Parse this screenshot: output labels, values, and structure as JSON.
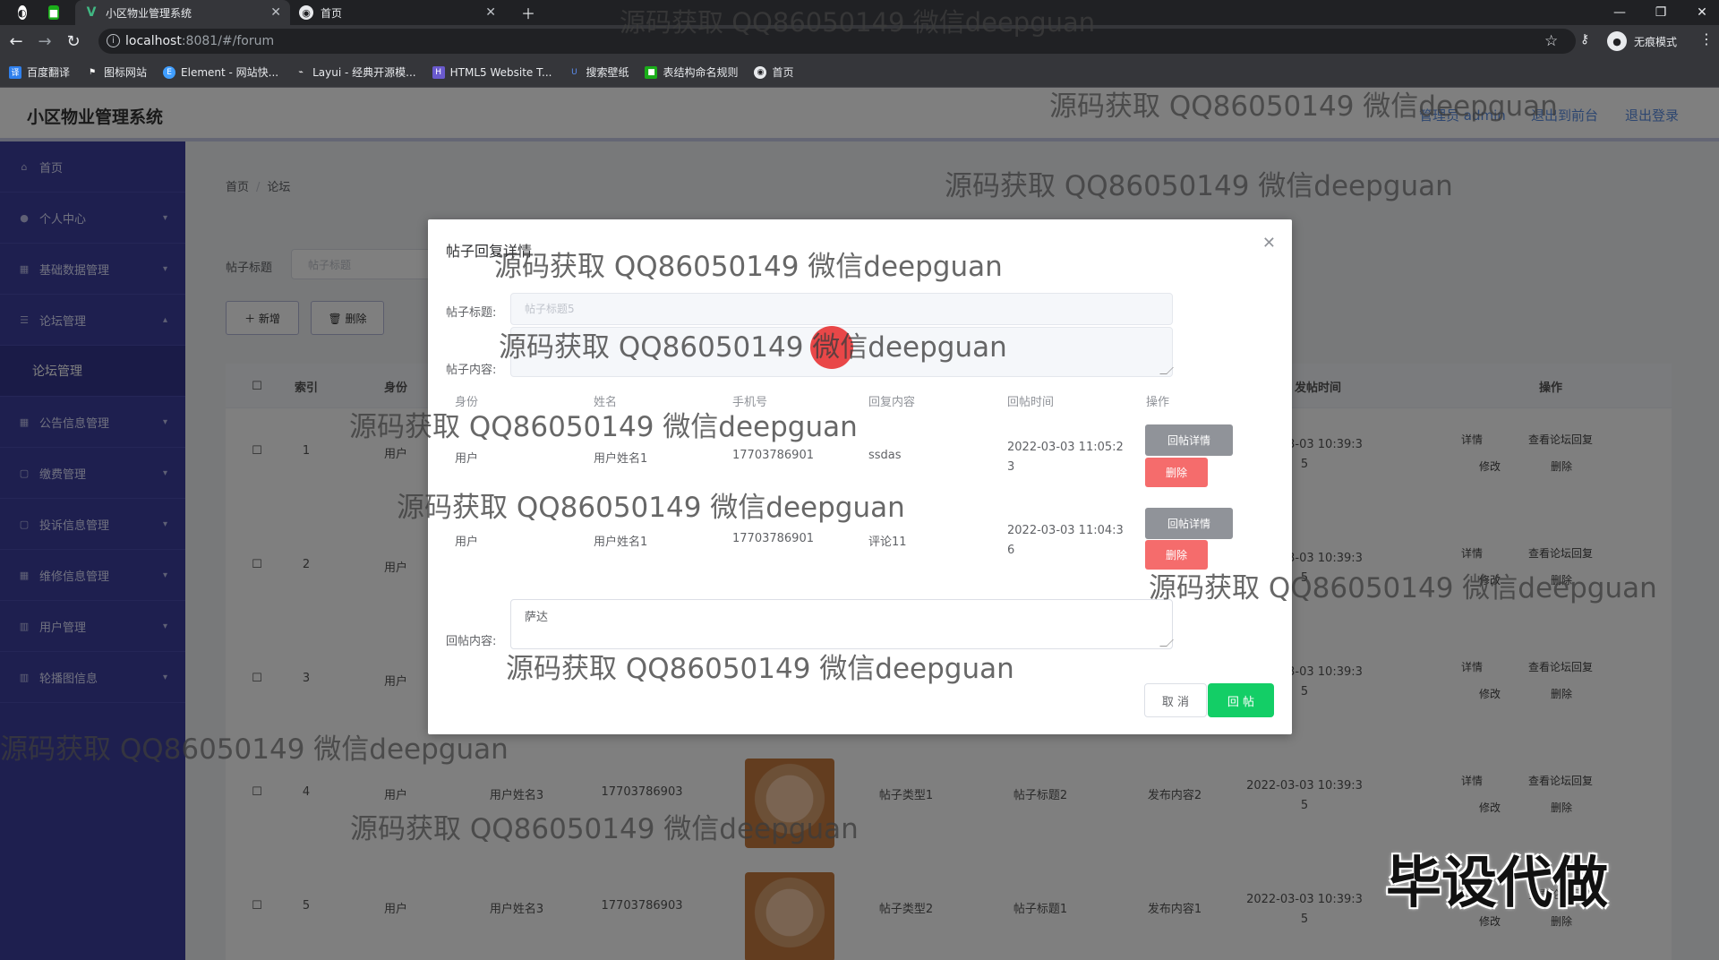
{
  "browser": {
    "tabs": [
      {
        "title": "小区物业管理系统"
      },
      {
        "title": "首页"
      }
    ],
    "url_host": "localhost",
    "url_rest": ":8081/#/forum",
    "incognito_label": "无痕模式",
    "bookmarks": [
      "百度翻译",
      "图标网站",
      "Element - 网站快...",
      "Layui - 经典开源模...",
      "HTML5 Website T...",
      "搜索壁纸",
      "表结构命名规则",
      "首页"
    ]
  },
  "app": {
    "title": "小区物业管理系统",
    "top_links": [
      "管理员 admin",
      "退出到前台",
      "退出登录"
    ],
    "sidebar": [
      {
        "label": "首页",
        "icon": "home-icon"
      },
      {
        "label": "个人中心",
        "icon": "user-icon"
      },
      {
        "label": "基础数据管理",
        "icon": "grid-icon"
      },
      {
        "label": "论坛管理",
        "icon": "list-icon",
        "expanded": true,
        "sub": "论坛管理"
      },
      {
        "label": "公告信息管理",
        "icon": "grid-icon"
      },
      {
        "label": "缴费管理",
        "icon": "grid-icon"
      },
      {
        "label": "投诉信息管理",
        "icon": "grid-icon"
      },
      {
        "label": "维修信息管理",
        "icon": "grid-icon"
      },
      {
        "label": "用户管理",
        "icon": "chart-icon"
      },
      {
        "label": "轮播图信息",
        "icon": "chart-icon"
      }
    ],
    "breadcrumb": [
      "首页",
      "论坛"
    ],
    "filter": {
      "label": "帖子标题",
      "placeholder": "帖子标题"
    },
    "buttons": {
      "add": "＋ 新增",
      "delete": "🗑 删除"
    },
    "table": {
      "headers": [
        "索引",
        "身份",
        "发帖时间",
        "操作"
      ],
      "rows": [
        {
          "index": "1",
          "role": "用户",
          "name": "",
          "phone": "",
          "type": "",
          "title": "",
          "content": "",
          "time": "2022-03-03 10:39:35"
        },
        {
          "index": "2",
          "role": "用户",
          "name": "",
          "phone": "",
          "type": "",
          "title": "",
          "content": "",
          "time": "2022-03-03 10:39:35"
        },
        {
          "index": "3",
          "role": "用户",
          "name": "",
          "phone": "",
          "type": "",
          "title": "",
          "content": "",
          "time": "2022-03-03 10:39:35"
        },
        {
          "index": "4",
          "role": "用户",
          "name": "用户姓名3",
          "phone": "17703786903",
          "type": "帖子类型1",
          "title": "帖子标题2",
          "content": "发布内容2",
          "time": "2022-03-03 10:39:35"
        },
        {
          "index": "5",
          "role": "用户",
          "name": "用户姓名3",
          "phone": "17703786903",
          "type": "帖子类型2",
          "title": "帖子标题1",
          "content": "发布内容1",
          "time": "2022-03-03 10:39:35"
        }
      ],
      "ops": {
        "detail": "详情",
        "view_reply": "查看论坛回复",
        "edit": "修改",
        "delete": "删除"
      }
    }
  },
  "dialog": {
    "title": "帖子回复详情",
    "title_label": "帖子标题:",
    "title_placeholder": "帖子标题5",
    "content_label": "帖子内容:",
    "reply_headers": [
      "身份",
      "姓名",
      "手机号",
      "回复内容",
      "回帖时间",
      "操作"
    ],
    "replies": [
      {
        "role": "用户",
        "name": "用户姓名1",
        "phone": "17703786901",
        "content": "ssdas",
        "time": "2022-03-03 11:05:23"
      },
      {
        "role": "用户",
        "name": "用户姓名1",
        "phone": "17703786901",
        "content": "评论11",
        "time": "2022-03-03 11:04:36"
      }
    ],
    "reply_detail_btn": "回帖详情",
    "reply_delete_btn": "删除",
    "reply_label": "回帖内容:",
    "reply_value": "萨达",
    "cancel": "取 消",
    "submit": "回 帖"
  },
  "watermark": "源码获取 QQ86050149 微信deepguan",
  "stamp": "毕设代做"
}
